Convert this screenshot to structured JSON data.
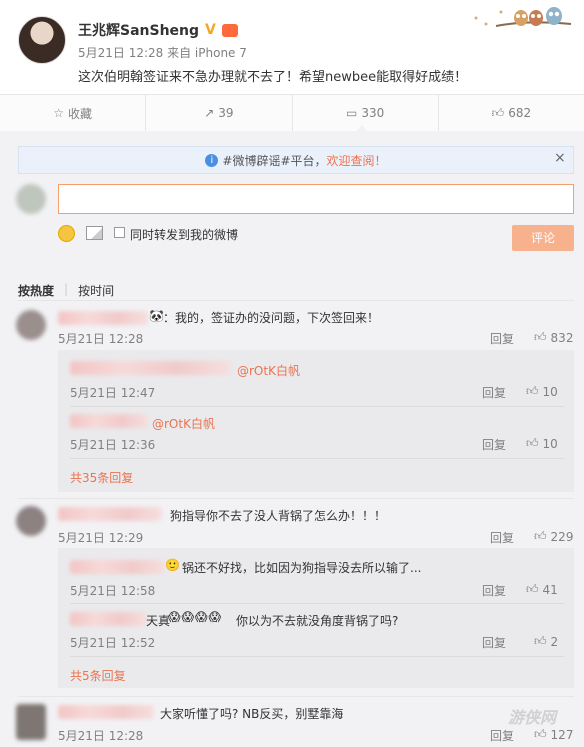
{
  "post": {
    "author": "王兆辉SanSheng",
    "verified_badge": "V",
    "meta": "5月21日 12:28 来自 iPhone 7",
    "content": "这次伯明翰签证来不急办理就不去了！希望newbee能取得好成绩！"
  },
  "actions": {
    "collect": "收藏",
    "repost_count": "39",
    "comment_count": "330",
    "like_count": "682"
  },
  "notice": {
    "prefix": "#微博辟谣#平台，",
    "link": "欢迎查阅！",
    "close": "×"
  },
  "composer": {
    "repost_label": "同时转发到我的微博",
    "submit_label": "评论"
  },
  "sort": {
    "hot": "按热度",
    "time": "按时间"
  },
  "comments": [
    {
      "text": "：我的，签证办的没问题，下次签回来！",
      "time": "5月21日 12:28",
      "reply": "回复",
      "likes": "832",
      "replies": [
        {
          "mention": "@rOtK白帆",
          "time": "5月21日 12:47",
          "reply": "回复",
          "likes": "10"
        },
        {
          "mention": "@rOtK白帆",
          "time": "5月21日 12:36",
          "reply": "回复",
          "likes": "10"
        }
      ],
      "more": "共35条回复"
    },
    {
      "text": "狗指导你不去了没人背锅了怎么办！！！",
      "time": "5月21日 12:29",
      "reply": "回复",
      "likes": "229",
      "replies": [
        {
          "text": "锅还不好找，比如因为狗指导没去所以输了...",
          "time": "5月21日 12:58",
          "reply": "回复",
          "likes": "41"
        },
        {
          "text": "你以为不去就没角度背锅了吗?",
          "prefix": "天真",
          "time": "5月21日 12:52",
          "reply": "回复",
          "likes": "2"
        }
      ],
      "more": "共5条回复"
    },
    {
      "text": "大家听懂了吗? NB反买，别墅靠海",
      "time": "5月21日 12:28",
      "reply": "回复",
      "likes": "127"
    }
  ],
  "watermark": "游侠网"
}
